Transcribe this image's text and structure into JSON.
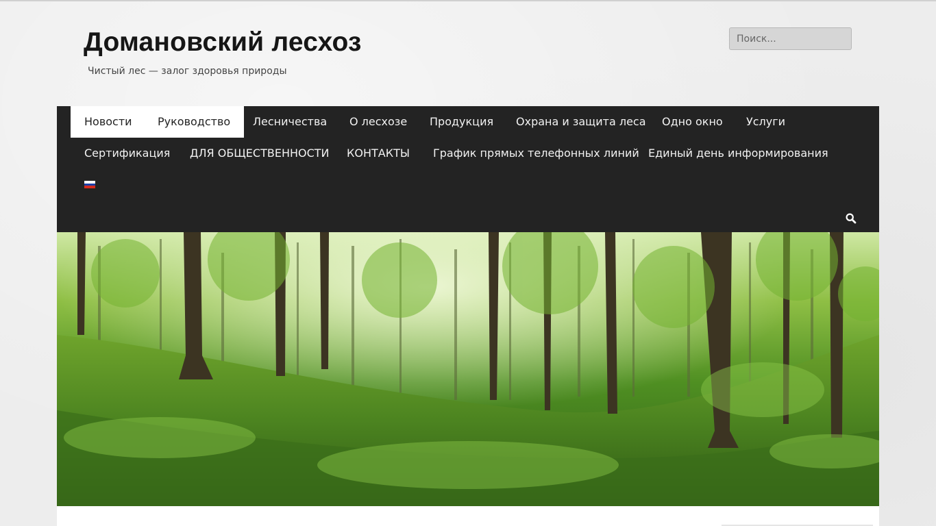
{
  "site": {
    "title": "Домановский лесхоз",
    "tagline": "Чистый лес — залог здоровья природы"
  },
  "search": {
    "placeholder": "Поиск..."
  },
  "nav": {
    "items": [
      {
        "label": "Новости",
        "active": true
      },
      {
        "label": "Руководство",
        "active": true
      },
      {
        "label": "Лесничества",
        "active": false
      },
      {
        "label": "О лесхозе",
        "active": false
      },
      {
        "label": "Продукция",
        "active": false
      },
      {
        "label": "Охрана и защита леса",
        "active": false
      },
      {
        "label": "Одно окно",
        "active": false
      },
      {
        "label": "Услуги",
        "active": false
      },
      {
        "label": "Сертификация",
        "active": false
      },
      {
        "label": "ДЛЯ ОБЩЕСТВЕННОСТИ",
        "active": false
      },
      {
        "label": "КОНТАКТЫ",
        "active": false
      },
      {
        "label": "График прямых телефонных линий",
        "active": false
      },
      {
        "label": "Единый день информирования",
        "active": false
      }
    ],
    "language_flag": "ru-flag-icon",
    "search_icon": "search-icon"
  },
  "hero": {
    "image": "forest-banner"
  },
  "colors": {
    "nav_bg": "#232323",
    "nav_text": "#f2f2f2",
    "active_bg": "#ffffff",
    "page_bg": "#ececec"
  }
}
